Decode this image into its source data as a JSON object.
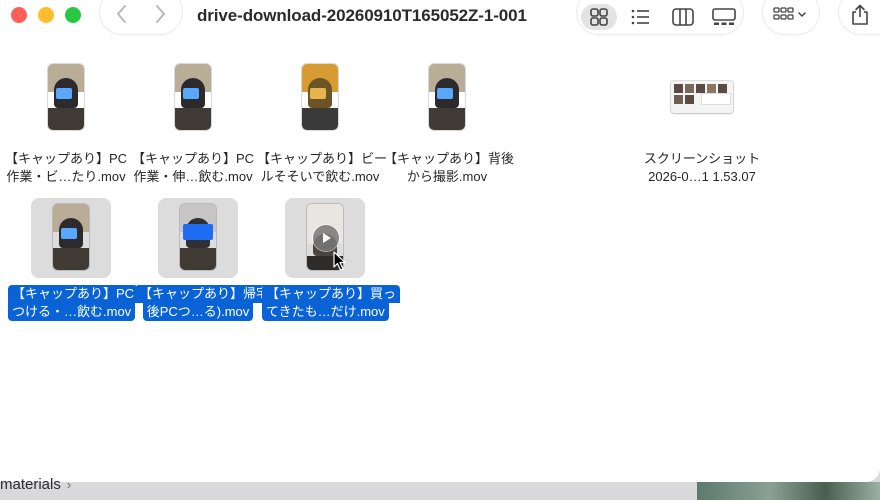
{
  "window": {
    "title": "drive-download-20260910T165052Z-1-001"
  },
  "toolbar": {
    "back_icon": "chevron-left-icon",
    "forward_icon": "chevron-right-icon",
    "views": [
      "icon-view-icon",
      "list-view-icon",
      "column-view-icon",
      "gallery-view-icon"
    ],
    "active_view": "icon-view-icon",
    "group_icon": "group-by-icon",
    "share_icon": "share-icon"
  },
  "files": [
    {
      "line1": "【キャップあり】PC",
      "line2": "作業・ビ…たり.mov",
      "selected": false
    },
    {
      "line1": "【キャップあり】PC",
      "line2": "作業・伸…飲む.mov",
      "selected": false
    },
    {
      "line1": "【キャップあり】ビー",
      "line2": "ルそそいで飲む.mov",
      "selected": false
    },
    {
      "line1": "【キャップあり】背後",
      "line2": "から撮影.mov",
      "selected": false
    },
    {
      "line1": "スクリーンショット",
      "line2": "2026-0…1 1.53.07",
      "selected": false
    },
    {
      "line1": "【キャップあり】PC",
      "line2": "つける・…飲む.mov",
      "selected": true
    },
    {
      "line1": "【キャップあり】帰宅",
      "line2": "後PCつ…る).mov",
      "selected": true
    },
    {
      "line1": "【キャップあり】買っ",
      "line2": "てきたも…だけ.mov",
      "selected": true
    }
  ],
  "background": {
    "breadcrumb": "materials",
    "breadcrumb_chevron": "›"
  },
  "colors": {
    "selection": "#0a63d6",
    "close": "#ff5f57",
    "minimize": "#febc2e",
    "maximize": "#28c840"
  }
}
